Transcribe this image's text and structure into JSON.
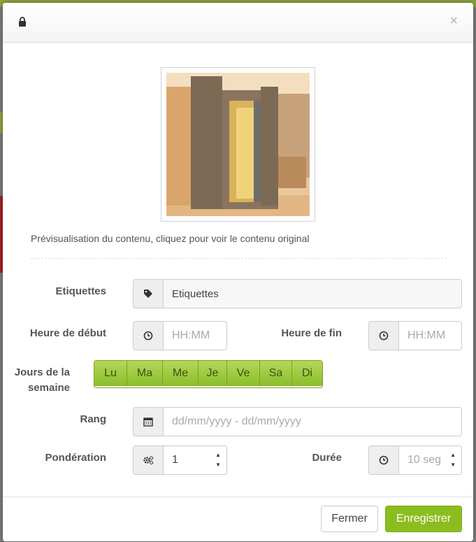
{
  "colors": {
    "accent_green": "#8cbd1f",
    "day_green": "#a6cf48",
    "label_gray": "#555555"
  },
  "header": {
    "lock_icon": "lock-icon",
    "close_label": "×"
  },
  "preview": {
    "caption": "Prévisualisation du contenu, cliquez pour voir le contenu original"
  },
  "form": {
    "tags": {
      "label": "Etiquettes",
      "icon": "tag-icon",
      "value": "Etiquettes"
    },
    "start_time": {
      "label": "Heure de début",
      "icon": "clock-icon",
      "placeholder": "HH:MM"
    },
    "end_time": {
      "label": "Heure de fin",
      "icon": "clock-icon",
      "placeholder": "HH:MM"
    },
    "weekdays": {
      "label_line1": "Jours de la",
      "label_line2": "semaine",
      "days": [
        "Lu",
        "Ma",
        "Me",
        "Je",
        "Ve",
        "Sa",
        "Di"
      ]
    },
    "range": {
      "label": "Rang",
      "icon": "calendar-icon",
      "placeholder": "dd/mm/yyyy - dd/mm/yyyy"
    },
    "weighting": {
      "label": "Pondération",
      "icon": "gears-icon",
      "value": "1"
    },
    "duration": {
      "label": "Durée",
      "icon": "clock-icon",
      "placeholder": "10 seg"
    }
  },
  "footer": {
    "close_label": "Fermer",
    "save_label": "Enregistrer"
  }
}
